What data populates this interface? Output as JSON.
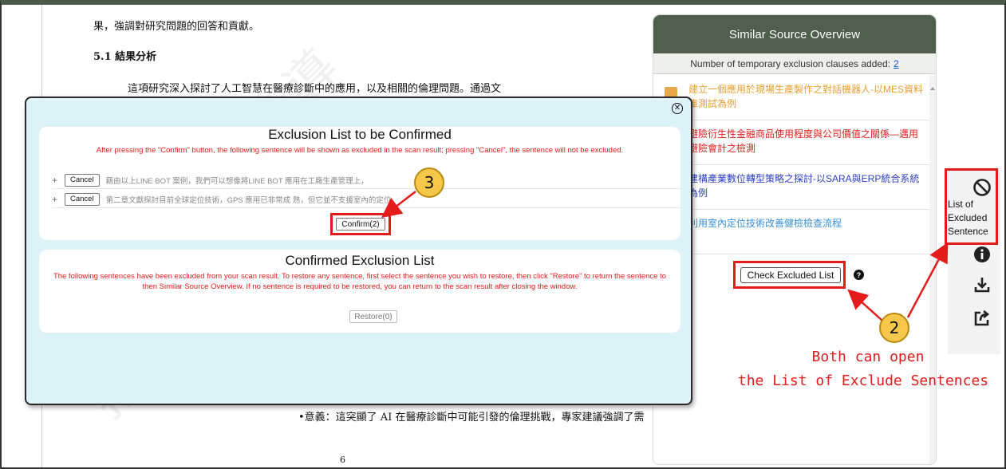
{
  "document": {
    "line_1": "果，強調對研究問題的回答和貢獻。",
    "heading": "5.1 結果分析",
    "line_2": "這項研究深入探討了人工智慧在醫療診斷中的應用，以及相關的倫理問題。通過文",
    "line_3": "•意義：這突顯了 AI 在醫療診斷中可能引發的倫理挑戰，專家建議強調了需",
    "page_number": "6"
  },
  "overview": {
    "title": "Similar Source Overview",
    "exclusion_label": "Number of temporary exclusion clauses added:",
    "exclusion_count": "2",
    "sources": [
      {
        "text": "建立一個應用於現場生產製作之對話機器人-以MES資料庫測試為例",
        "color": "#e8a030"
      },
      {
        "text": "避險衍生性金融商品使用程度與公司價值之關係—邁用避險會計之檢測",
        "color": "#e31b1b"
      },
      {
        "text": "建構產業數位轉型策略之探討-以SARA與ERP統合系統為例",
        "color": "#2b3fc4"
      },
      {
        "text": "利用室內定位技術改善健檢檢查流程",
        "color": "#3a8fd6"
      }
    ],
    "check_button": "Check Excluded List",
    "help_icon": "?"
  },
  "tools": {
    "excluded_label": "List of Excluded Sentence",
    "icons": [
      "ban-icon",
      "info-icon",
      "download-icon",
      "share-icon"
    ]
  },
  "annotations": {
    "callout_2": "2",
    "callout_3": "3",
    "note_line_1": "Both can open",
    "note_line_2": "the List of Exclude Sentences",
    "color": "#e31b1b"
  },
  "modal": {
    "pending": {
      "title": "Exclusion List to be Confirmed",
      "note": "After pressing the \"Confirm\" button, the following sentence will be shown as excluded in the scan result; pressing \"Cancel\", the sentence will not be excluded.",
      "rows": [
        {
          "plus": "+",
          "cancel": "Cancel",
          "text": "藉由以上LINE BOT 案例，我們可以想像將LINE BOT 應用在工廠生產管理上，"
        },
        {
          "plus": "+",
          "cancel": "Cancel",
          "text": "第二章文獻探討目前全球定位技術，GPS 應用已非常成 熟，但它並不支援室內的定位，"
        }
      ],
      "confirm_button": "Confirm(2)"
    },
    "confirmed": {
      "title": "Confirmed Exclusion List",
      "note": "The following sentences have been excluded from your scan result. To restore any sentence, first select the sentence you wish to restore, then click \"Restore\" to return the sentence to then Similar Source Overview. If no sentence is required to be restored, you can return to the scan result after closing the window.",
      "restore_button": "Restore(0)"
    }
  }
}
